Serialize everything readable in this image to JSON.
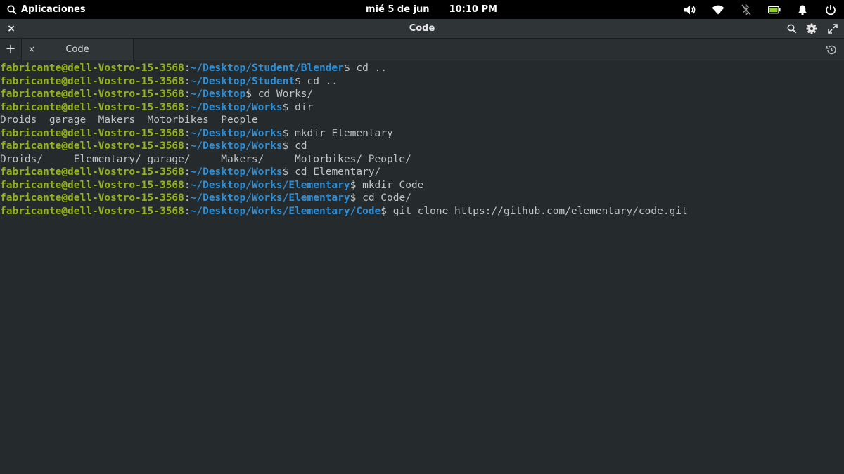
{
  "panel": {
    "apps_label": "Aplicaciones",
    "date": "mié  5 de jun",
    "time": "10:10 PM",
    "icons": [
      "volume-icon",
      "wifi-icon",
      "bluetooth-off-icon",
      "battery-icon",
      "notifications-icon",
      "power-icon"
    ]
  },
  "window": {
    "title": "Code",
    "close_glyph": "×",
    "new_tab_glyph": "+",
    "tab_close_glyph": "×",
    "tabs": [
      {
        "label": "Code"
      }
    ]
  },
  "colors": {
    "user": "#94b315",
    "path": "#2d8fd8",
    "text": "#bfc3c5",
    "background": "#252a2c"
  },
  "terminal": {
    "prompt_user": "fabricante@dell-Vostro-15-3568",
    "lines": [
      {
        "type": "prompt",
        "path": "~/Desktop/Student/Blender",
        "cmd": "cd .."
      },
      {
        "type": "prompt",
        "path": "~/Desktop/Student",
        "cmd": "cd .."
      },
      {
        "type": "prompt",
        "path": "~/Desktop",
        "cmd": "cd Works/"
      },
      {
        "type": "prompt",
        "path": "~/Desktop/Works",
        "cmd": "dir"
      },
      {
        "type": "output",
        "text": "Droids  garage  Makers  Motorbikes  People"
      },
      {
        "type": "prompt",
        "path": "~/Desktop/Works",
        "cmd": "mkdir Elementary"
      },
      {
        "type": "prompt",
        "path": "~/Desktop/Works",
        "cmd": "cd"
      },
      {
        "type": "output",
        "text": "Droids/     Elementary/ garage/     Makers/     Motorbikes/ People/"
      },
      {
        "type": "prompt",
        "path": "~/Desktop/Works",
        "cmd": "cd Elementary/"
      },
      {
        "type": "prompt",
        "path": "~/Desktop/Works/Elementary",
        "cmd": "mkdir Code"
      },
      {
        "type": "prompt",
        "path": "~/Desktop/Works/Elementary",
        "cmd": "cd Code/"
      },
      {
        "type": "prompt",
        "path": "~/Desktop/Works/Elementary/Code",
        "cmd": "git clone https://github.com/elementary/code.git"
      }
    ]
  }
}
